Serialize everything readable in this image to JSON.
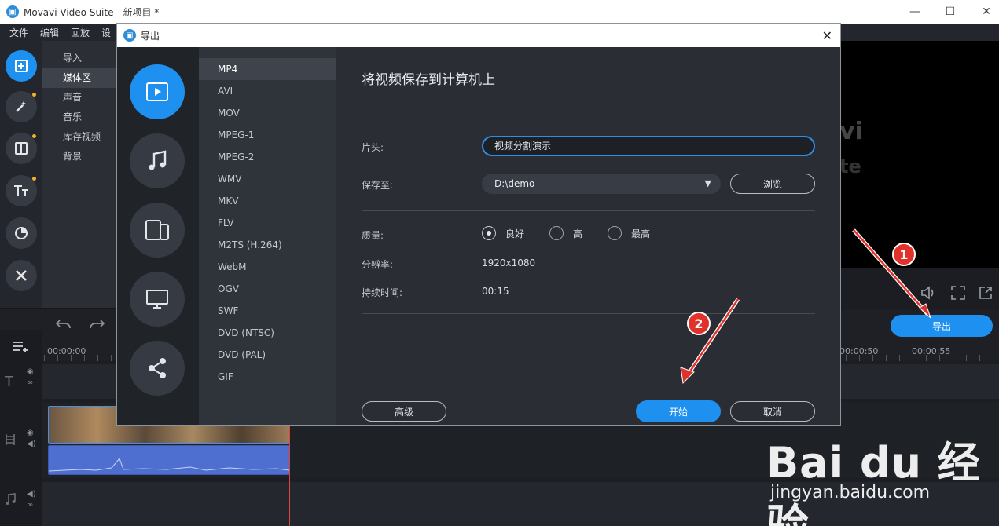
{
  "app": {
    "window_title": "Movavi Video Suite - 新项目 *",
    "app_icon_glyph": "▣",
    "controls": {
      "minimize": "—",
      "maximize": "☐",
      "close": "✕"
    }
  },
  "menubar": {
    "items": [
      "文件",
      "编辑",
      "回放",
      "设"
    ]
  },
  "rail": {
    "icons": [
      "import-icon",
      "magic-wand-icon",
      "transition-icon",
      "titles-icon",
      "stickers-icon",
      "tools-icon"
    ]
  },
  "submenu": {
    "items": [
      "导入",
      "媒体区",
      "声音",
      "音乐",
      "库存视频",
      "背景"
    ],
    "selected": "媒体区"
  },
  "player": {
    "brand_line1": "vi",
    "brand_line2": "te"
  },
  "timeline": {
    "ticks": [
      "00:00:00",
      "00:00:50",
      "00:00:55"
    ],
    "export_button": "导出"
  },
  "dialog": {
    "title": "导出",
    "close": "✕",
    "categories": [
      "video-icon",
      "music-icon",
      "devices-icon",
      "tv-icon",
      "share-icon"
    ],
    "formats": [
      "MP4",
      "AVI",
      "MOV",
      "MPEG-1",
      "MPEG-2",
      "WMV",
      "MKV",
      "FLV",
      "M2TS (H.264)",
      "WebM",
      "OGV",
      "SWF",
      "DVD (NTSC)",
      "DVD (PAL)",
      "GIF"
    ],
    "selected_format": "MP4",
    "heading": "将视频保存到计算机上",
    "title_label": "片头:",
    "title_value": "视频分割演示",
    "save_label": "保存至:",
    "save_value": "D:\\demo",
    "browse": "浏览",
    "quality_label": "质量:",
    "quality_options": [
      "良好",
      "高",
      "最高"
    ],
    "quality_selected": "良好",
    "resolution_label": "分辨率:",
    "resolution_value": "1920x1080",
    "duration_label": "持续时间:",
    "duration_value": "00:15",
    "advanced": "高级",
    "start": "开始",
    "cancel": "取消"
  },
  "annotations": {
    "badge1": "1",
    "badge2": "2"
  },
  "watermark": {
    "logo": "Bai du 经验",
    "url": "jingyan.baidu.com"
  }
}
